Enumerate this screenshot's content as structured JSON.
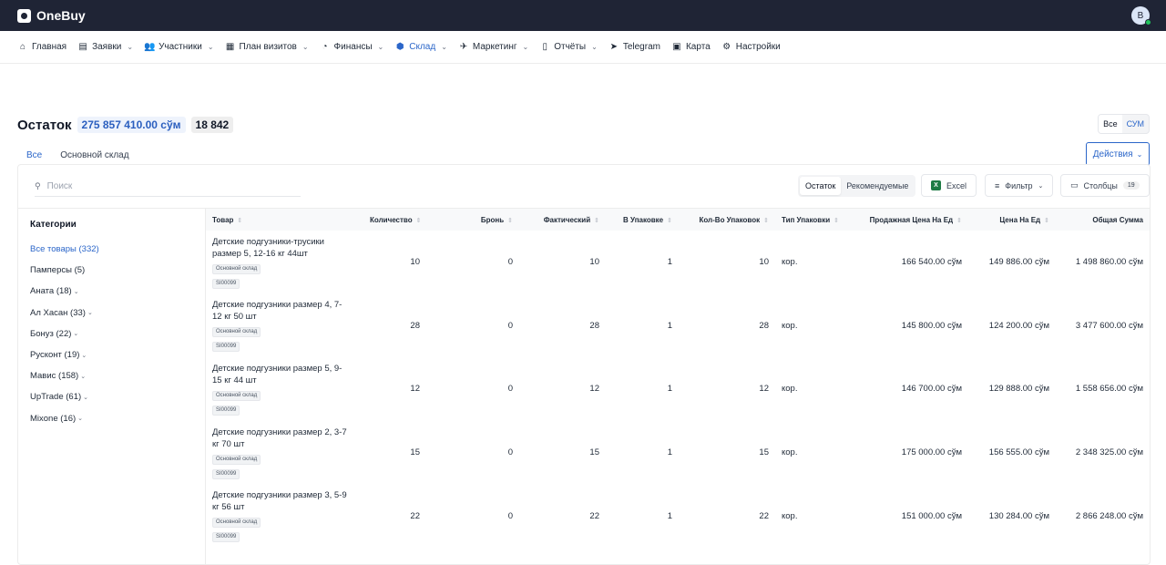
{
  "app": {
    "brand": "OneBuy",
    "avatar_letter": "B"
  },
  "nav": [
    {
      "icon": "⌂",
      "label": "Главная",
      "chevron": false,
      "active": false,
      "name": "home"
    },
    {
      "icon": "▤",
      "label": "Заявки",
      "chevron": true,
      "active": false,
      "name": "orders"
    },
    {
      "icon": "👥",
      "label": "Участники",
      "chevron": true,
      "active": false,
      "name": "participants"
    },
    {
      "icon": "▦",
      "label": "План визитов",
      "chevron": true,
      "active": false,
      "name": "visit-plan"
    },
    {
      "icon": "◔",
      "label": "Финансы",
      "chevron": true,
      "active": false,
      "name": "finance"
    },
    {
      "icon": "⬢",
      "label": "Склад",
      "chevron": true,
      "active": true,
      "name": "warehouse"
    },
    {
      "icon": "✈",
      "label": "Маркетинг",
      "chevron": true,
      "active": false,
      "name": "marketing"
    },
    {
      "icon": "▯",
      "label": "Отчёты",
      "chevron": true,
      "active": false,
      "name": "reports"
    },
    {
      "icon": "➤",
      "label": "Telegram",
      "chevron": false,
      "active": false,
      "name": "telegram"
    },
    {
      "icon": "▣",
      "label": "Карта",
      "chevron": false,
      "active": false,
      "name": "map"
    },
    {
      "icon": "⚙",
      "label": "Настройки",
      "chevron": false,
      "active": false,
      "name": "settings"
    }
  ],
  "header": {
    "title": "Остаток",
    "total_sum": "275 857 410.00 сўм",
    "total_count": "18 842",
    "currency_all": "Все",
    "currency_sum": "СУМ",
    "actions_label": "Действия"
  },
  "tabs": [
    "Все",
    "Основной склад"
  ],
  "toolbar": {
    "search_placeholder": "Поиск",
    "mode_on": "Остаток",
    "mode_off": "Рекомендуемые",
    "excel": "Excel",
    "filter": "Фильтр",
    "columns": "Столбцы",
    "columns_count": "19"
  },
  "sidebar": {
    "title": "Категории",
    "items": [
      {
        "label": "Все товары (332)",
        "active": true,
        "chevron": false
      },
      {
        "label": "Памперсы (5)",
        "active": false,
        "chevron": false
      },
      {
        "label": "Аната (18)",
        "active": false,
        "chevron": true
      },
      {
        "label": "Ал Хасан (33)",
        "active": false,
        "chevron": true
      },
      {
        "label": "Бонуз (22)",
        "active": false,
        "chevron": true
      },
      {
        "label": "Русконт (19)",
        "active": false,
        "chevron": true
      },
      {
        "label": "Мавис (158)",
        "active": false,
        "chevron": true
      },
      {
        "label": "UpTrade (61)",
        "active": false,
        "chevron": true
      },
      {
        "label": "Mixone (16)",
        "active": false,
        "chevron": true
      }
    ]
  },
  "table": {
    "columns": [
      "Товар",
      "Количество",
      "Бронь",
      "Фактический",
      "В Упаковке",
      "Кол-Во Упаковок",
      "Тип Упаковки",
      "Продажная Цена На Ед",
      "Цена На Ед",
      "Общая Сумма"
    ],
    "rows": [
      {
        "name": "Детские подгузники-трусики размер 5, 12-16 кг 44шт",
        "tag1": "Основной склад",
        "tag2": "SI00099",
        "qty": "10",
        "bron": "0",
        "fact": "10",
        "pack": "1",
        "packs": "10",
        "type": "кор.",
        "sale": "166 540.00 сўм",
        "price": "149 886.00 сўм",
        "total": "1 498 860.00 сўм"
      },
      {
        "name": "Детские подгузники размер 4, 7-12 кг 50 шт",
        "tag1": "Основной склад",
        "tag2": "SI00099",
        "qty": "28",
        "bron": "0",
        "fact": "28",
        "pack": "1",
        "packs": "28",
        "type": "кор.",
        "sale": "145 800.00 сўм",
        "price": "124 200.00 сўм",
        "total": "3 477 600.00 сўм"
      },
      {
        "name": "Детские подгузники размер 5, 9-15 кг 44 шт",
        "tag1": "Основной склад",
        "tag2": "SI00099",
        "qty": "12",
        "bron": "0",
        "fact": "12",
        "pack": "1",
        "packs": "12",
        "type": "кор.",
        "sale": "146 700.00 сўм",
        "price": "129 888.00 сўм",
        "total": "1 558 656.00 сўм"
      },
      {
        "name": "Детские подгузники размер 2, 3-7 кг 70 шт",
        "tag1": "Основной склад",
        "tag2": "SI00099",
        "qty": "15",
        "bron": "0",
        "fact": "15",
        "pack": "1",
        "packs": "15",
        "type": "кор.",
        "sale": "175 000.00 сўм",
        "price": "156 555.00 сўм",
        "total": "2 348 325.00 сўм"
      },
      {
        "name": "Детские подгузники размер 3, 5-9 кг 56 шт",
        "tag1": "Основной склад",
        "tag2": "SI00099",
        "qty": "22",
        "bron": "0",
        "fact": "22",
        "pack": "1",
        "packs": "22",
        "type": "кор.",
        "sale": "151 000.00 сўм",
        "price": "130 284.00 сўм",
        "total": "2 866 248.00 сўм"
      }
    ]
  }
}
